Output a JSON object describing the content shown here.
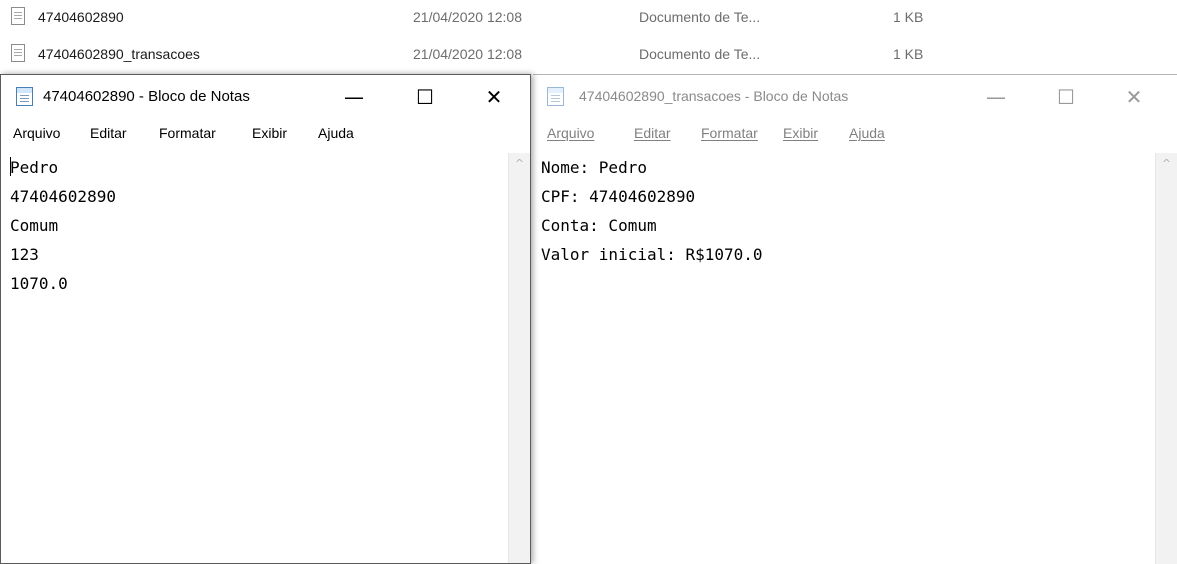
{
  "explorer": {
    "files": [
      {
        "name": "47404602890",
        "date": "21/04/2020 12:08",
        "type": "Documento de Te...",
        "size": "1 KB",
        "icon": "text-file-icon"
      },
      {
        "name": "47404602890_transacoes",
        "date": "21/04/2020 12:08",
        "type": "Documento de Te...",
        "size": "1 KB",
        "icon": "text-file-icon"
      }
    ]
  },
  "notepad_left": {
    "title": "47404602890 - Bloco de Notas",
    "icon": "notepad-icon",
    "controls": {
      "minimize": "—",
      "maximize": "☐",
      "close": "✕"
    },
    "menu": [
      "Arquivo",
      "Editar",
      "Formatar",
      "Exibir",
      "Ajuda"
    ],
    "lines": [
      "Pedro",
      "47404602890",
      "Comum",
      "123",
      "1070.0"
    ],
    "scroll_up_glyph": "^"
  },
  "notepad_right": {
    "title": "47404602890_transacoes - Bloco de Notas",
    "icon": "notepad-icon",
    "controls": {
      "minimize": "—",
      "maximize": "☐",
      "close": "✕"
    },
    "menu": [
      "Arquivo",
      "Editar",
      "Formatar",
      "Exibir",
      "Ajuda"
    ],
    "lines": [
      "Nome: Pedro",
      "CPF: 47404602890",
      "Conta: Comum",
      "Valor inicial: R$1070.0"
    ],
    "scroll_up_glyph": "^"
  }
}
